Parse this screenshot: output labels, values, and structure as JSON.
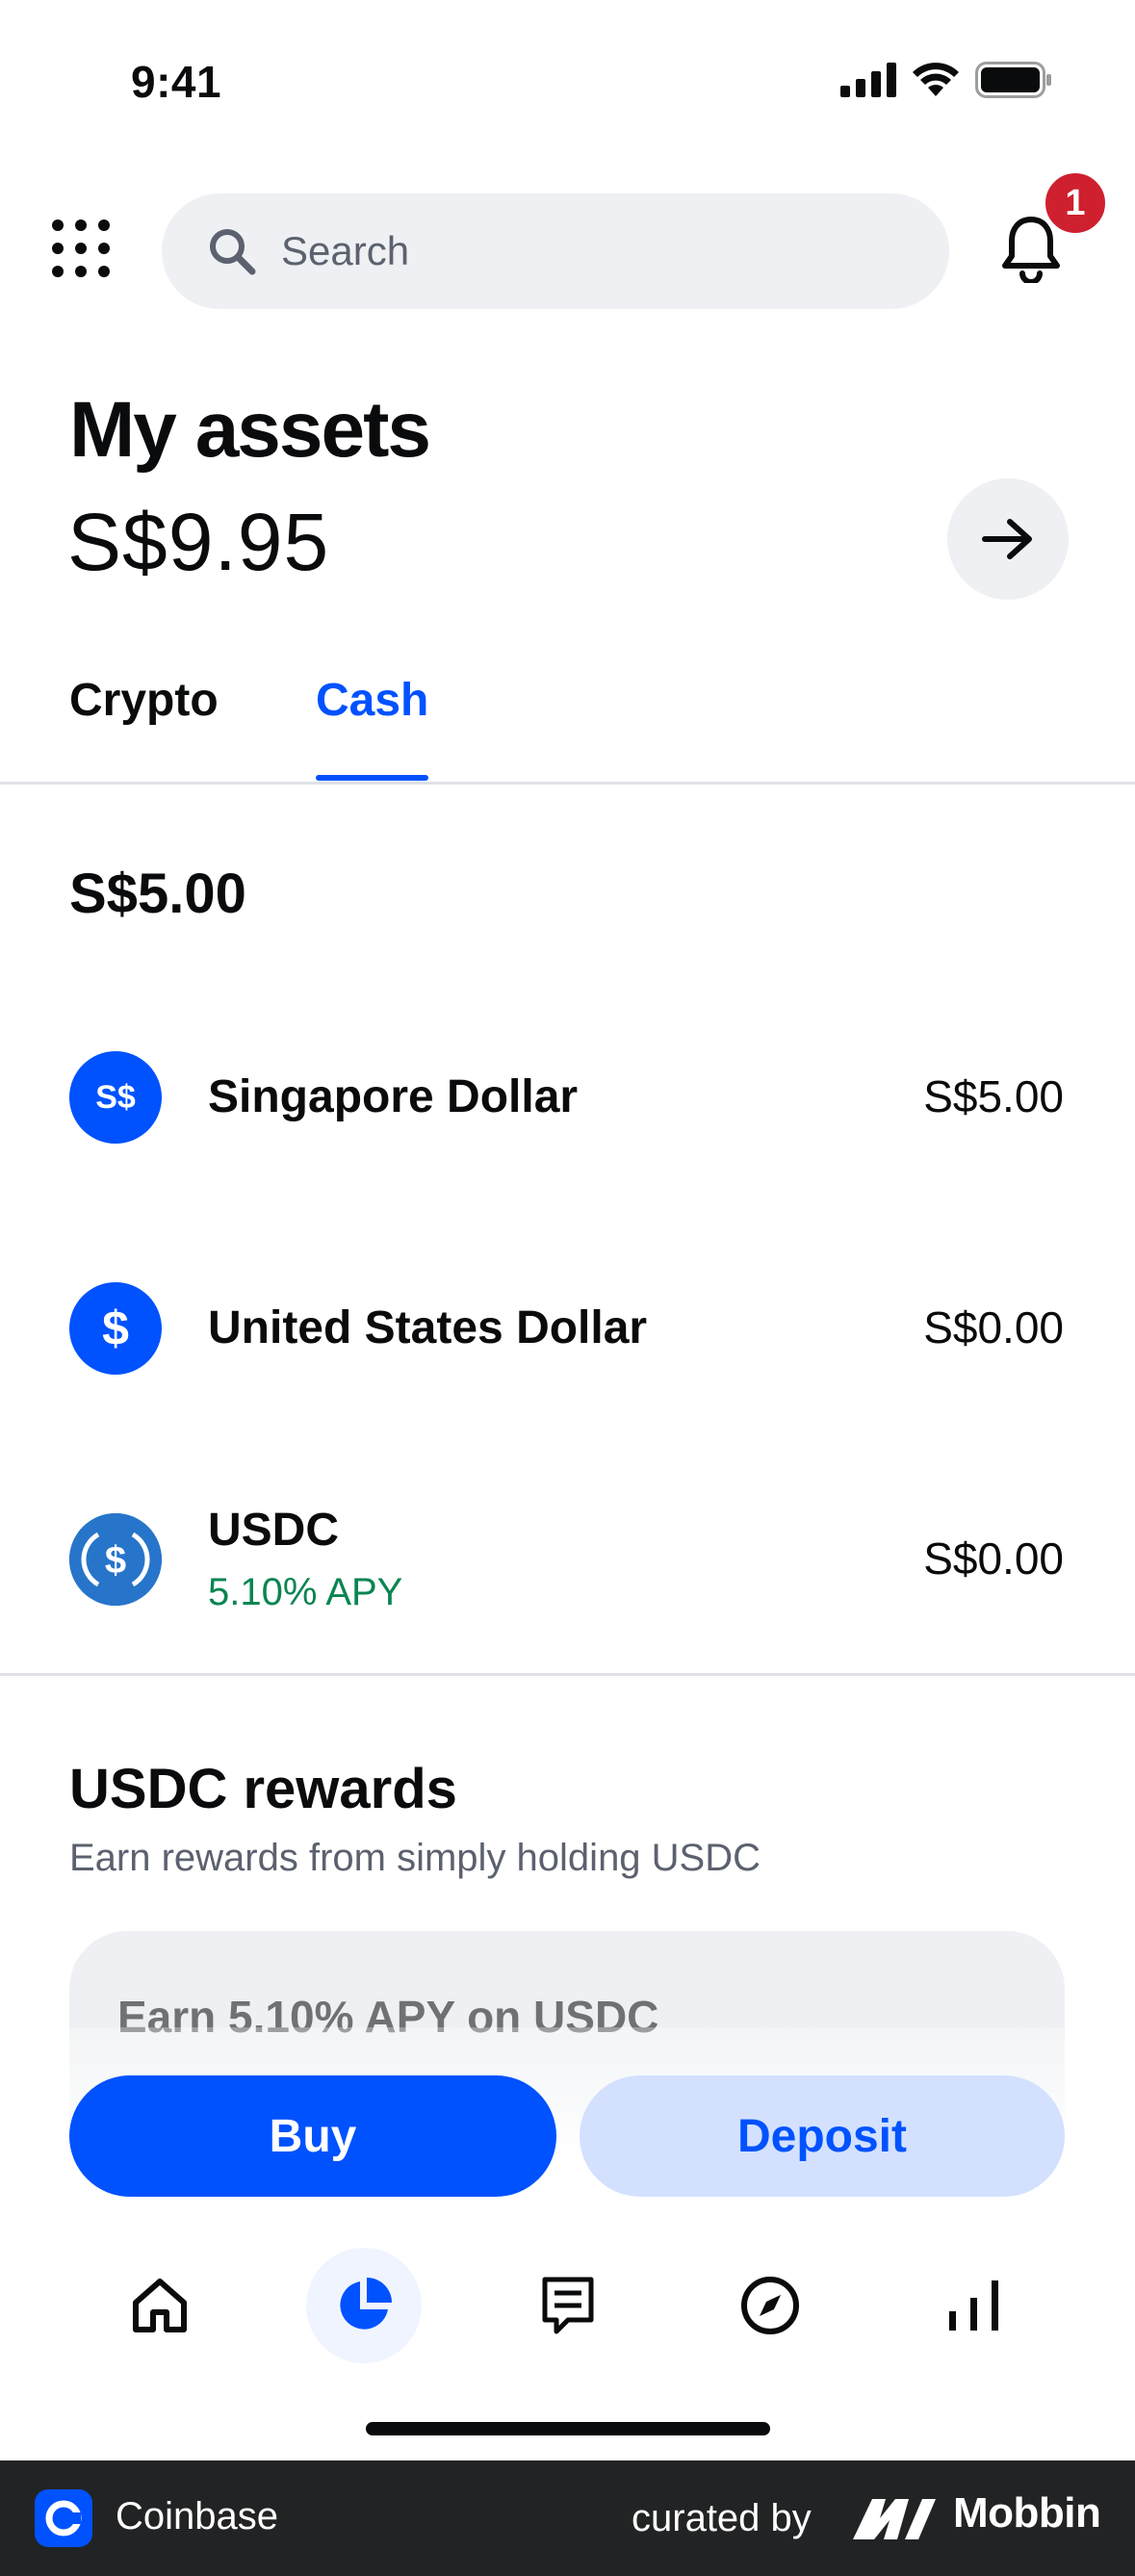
{
  "status_bar": {
    "time": "9:41"
  },
  "header": {
    "search_placeholder": "Search",
    "notification_count": "1"
  },
  "assets": {
    "title": "My assets",
    "total": "S$9.95"
  },
  "tabs": [
    {
      "label": "Crypto",
      "active": false
    },
    {
      "label": "Cash",
      "active": true
    }
  ],
  "cash": {
    "total": "S$5.00",
    "items": [
      {
        "icon_text": "S$",
        "icon": "sgd-icon",
        "name": "Singapore Dollar",
        "value": "S$5.00"
      },
      {
        "icon_text": "$",
        "icon": "usd-icon",
        "name": "United States Dollar",
        "value": "S$0.00"
      },
      {
        "icon": "usdc-icon",
        "name": "USDC",
        "sub": "5.10% APY",
        "value": "S$0.00"
      }
    ]
  },
  "rewards": {
    "title": "USDC rewards",
    "subtitle": "Earn rewards from simply holding USDC",
    "promo_title": "Earn 5.10% APY on USDC"
  },
  "actions": {
    "buy": "Buy",
    "deposit": "Deposit"
  },
  "nav": [
    {
      "icon": "home-icon",
      "active": false
    },
    {
      "icon": "portfolio-icon",
      "active": true
    },
    {
      "icon": "transactions-icon",
      "active": false
    },
    {
      "icon": "explore-icon",
      "active": false
    },
    {
      "icon": "markets-icon",
      "active": false
    }
  ],
  "footer": {
    "app_name": "Coinbase",
    "curated_by": "curated by",
    "brand": "Mobbin"
  },
  "colors": {
    "accent": "#0052ff",
    "positive": "#098551",
    "badge": "#cf202f"
  }
}
